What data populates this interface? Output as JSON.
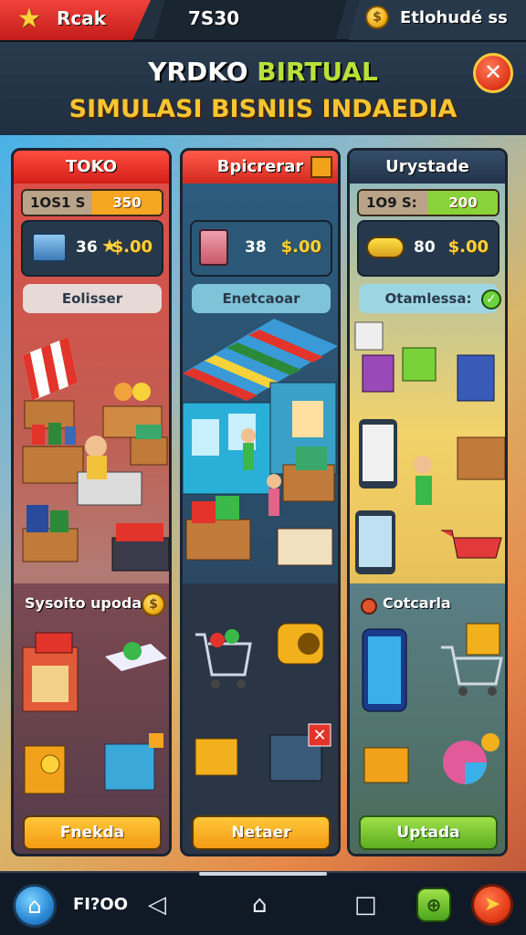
{
  "topbar": {
    "left_label": "Rcak",
    "center_value": "7S30",
    "right_label": "Etlohudé ss"
  },
  "header": {
    "title_white": "YRDKO ",
    "title_green": "BIRTUAL",
    "subtitle": "SIMULASI BISNIIS INDAEDIA"
  },
  "columns": [
    {
      "title": "TOKO",
      "stat_a": "1OS1 S",
      "stat_b": "350",
      "count": "36",
      "money": "$.00",
      "pill": "Eolisser",
      "section": "Sysoito upoda",
      "button": "Fnekda"
    },
    {
      "title": "Bpicrerar",
      "count": "38",
      "money": "$.00",
      "pill": "Enetcaoar",
      "button": "Netaer"
    },
    {
      "title": "Urystade",
      "stat_a": "1O9 S:",
      "stat_b": "200",
      "count": "80",
      "money": "$.00",
      "pill": "Otamlessa:",
      "section": "Cotcarla",
      "button": "Uptada"
    }
  ],
  "navbar": {
    "label": "FI?OO"
  },
  "colors": {
    "accent_red": "#e23a1d",
    "accent_yellow": "#f7c531",
    "accent_green": "#8ad23a",
    "panel_dark": "#1d2b3d"
  },
  "icons": [
    "star-icon",
    "coin-icon",
    "close-icon",
    "home-icon",
    "back-icon",
    "circle-home-icon",
    "recents-icon",
    "game-controller-icon",
    "compass-icon",
    "cart-icon",
    "check-icon"
  ]
}
